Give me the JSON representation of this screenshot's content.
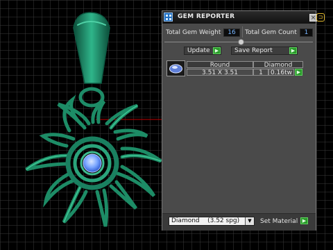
{
  "panel": {
    "title": "GEM REPORTER",
    "close_glyph": "×",
    "total_weight_label": "Total Gem Weight",
    "total_weight_value": "16",
    "total_count_label": "Total Gem Count",
    "total_count_value": "1",
    "update_label": "Update",
    "save_report_label": "Save Report",
    "table": {
      "headers": [
        "Round",
        "Diamond"
      ],
      "row": {
        "size": "3.51 X 3.51",
        "count": "1",
        "weight": "0.16tw"
      }
    },
    "material_select": {
      "name": "Diamond",
      "spec": "(3.52 spg)"
    },
    "set_material_label": "Set Material"
  },
  "icons": {
    "app": "gem-reporter-app-icon",
    "close": "close-icon",
    "external": "external-toolbar-icon",
    "play": "green-play-icon",
    "dropdown": "dropdown-arrow-icon",
    "gem": "round-gem-icon"
  },
  "colors": {
    "viewport_bg": "#000000",
    "grid": "#3a3a3a",
    "jewelry": "#1f8a6a",
    "gem_blue": "#6fa0ff",
    "axis_red": "#cc0000",
    "panel_bg": "#4a4a4a",
    "value_text": "#78b6ff",
    "play_green": "#2a9a2a"
  }
}
